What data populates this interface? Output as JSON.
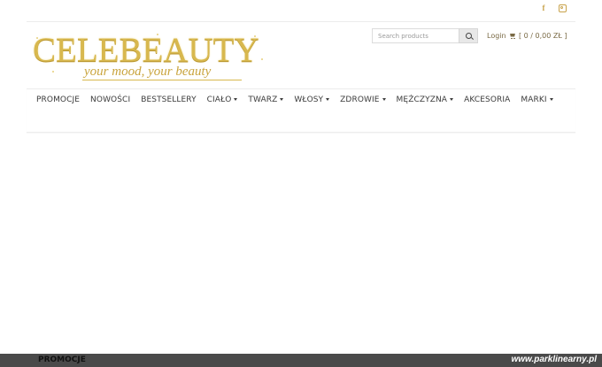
{
  "social": {
    "facebook_icon": "facebook-icon",
    "instagram_icon": "instagram-icon",
    "facebook_glyph": "f"
  },
  "logo": {
    "name": "CELEBEAUTY",
    "tagline": "your mood, your beauty",
    "color": "#d8b84e"
  },
  "search": {
    "placeholder": "Search products",
    "value": "",
    "button_icon": "search-icon"
  },
  "account": {
    "login_label": "Login",
    "cart_icon": "cart-icon",
    "cart_label": "[ 0 / 0,00 ZŁ ]"
  },
  "nav": {
    "items": [
      {
        "label": "PROMOCJE",
        "dropdown": false
      },
      {
        "label": "NOWOŚCI",
        "dropdown": false
      },
      {
        "label": "BESTSELLERY",
        "dropdown": false
      },
      {
        "label": "CIAŁO",
        "dropdown": true
      },
      {
        "label": "TWARZ",
        "dropdown": true
      },
      {
        "label": "WŁOSY",
        "dropdown": true
      },
      {
        "label": "ZDROWIE",
        "dropdown": true
      },
      {
        "label": "MĘŻCZYZNA",
        "dropdown": true
      },
      {
        "label": "AKCESORIA",
        "dropdown": false
      },
      {
        "label": "MARKI",
        "dropdown": true
      }
    ]
  },
  "footer": {
    "link_label": "PROMOCJE",
    "watermark": "www.parklinearny.pl",
    "bar_color": "#4a4a4a"
  }
}
